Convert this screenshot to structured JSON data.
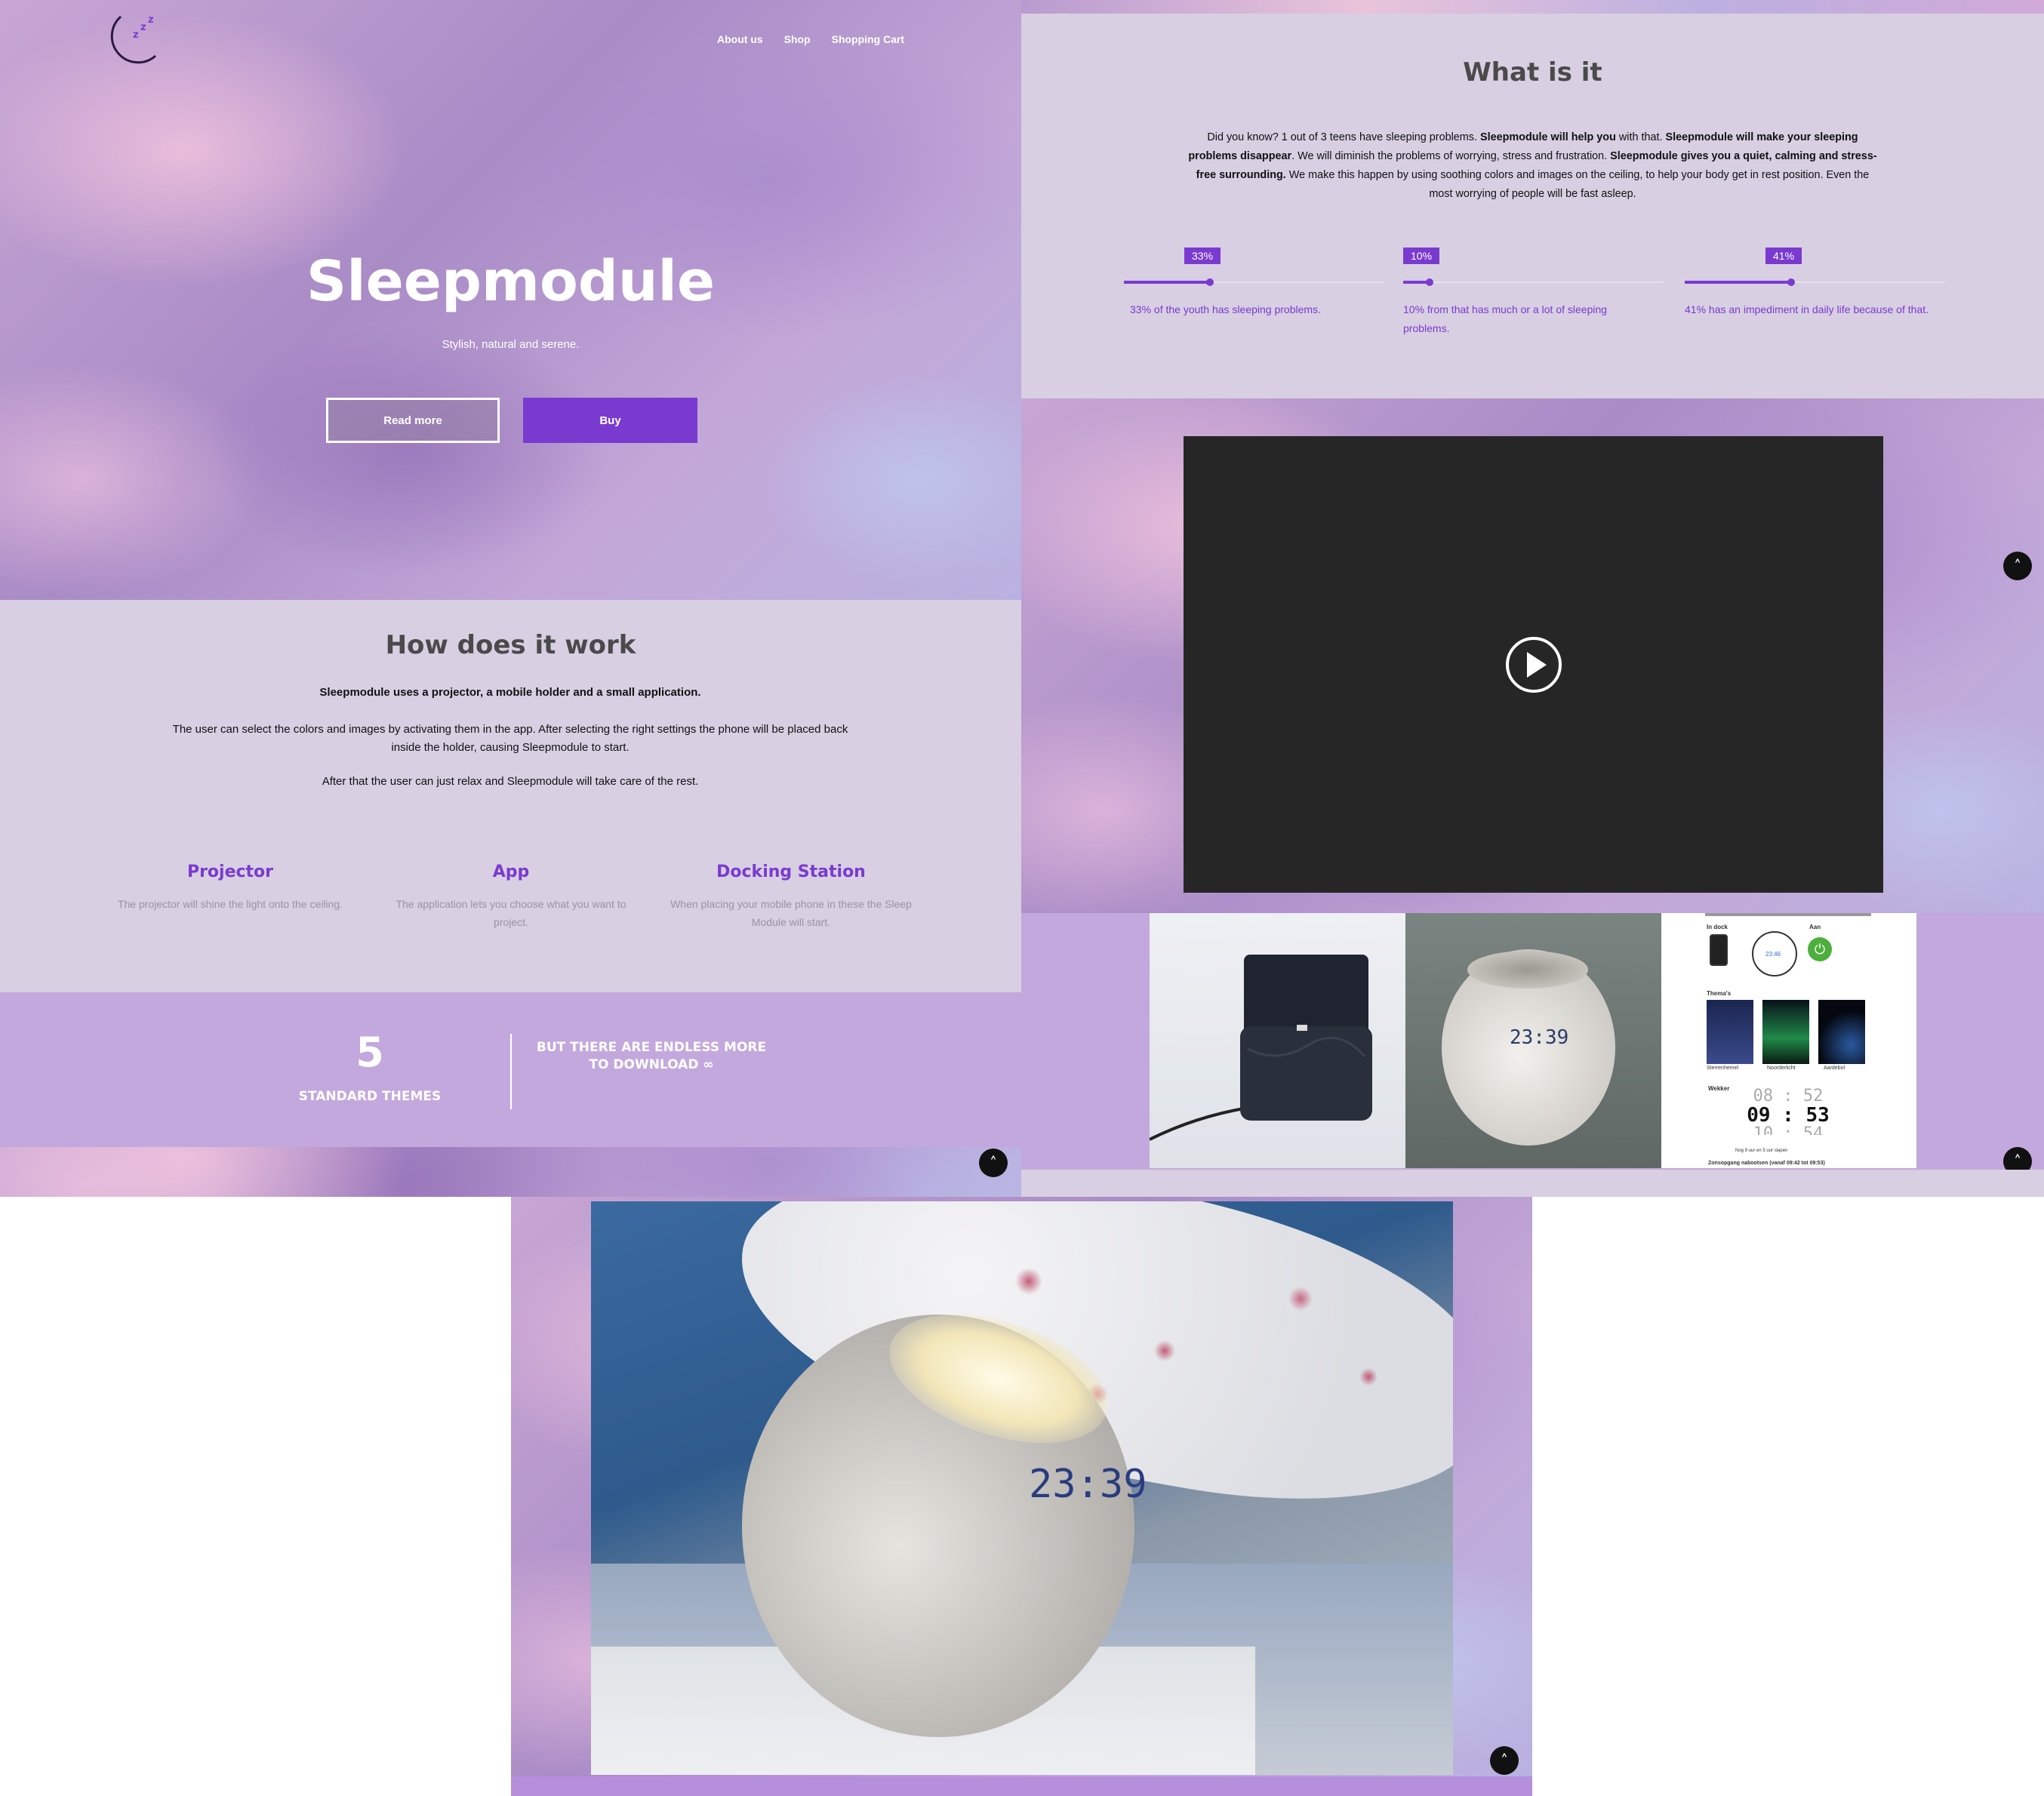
{
  "nav": {
    "about": "About us",
    "shop": "Shop",
    "cart": "Shopping Cart"
  },
  "hero": {
    "title": "Sleepmodule",
    "subtitle": "Stylish, natural and serene.",
    "read_more": "Read more",
    "buy": "Buy"
  },
  "how": {
    "title": "How does it work",
    "lead": "Sleepmodule uses a projector, a mobile holder and a small application.",
    "p1": "The user can select the colors and images by activating them in the app. After selecting the right settings the phone will be placed back inside the holder, causing Sleepmodule to start.",
    "p2": "After that the user can just relax and Sleepmodule will take care of the rest."
  },
  "features": [
    {
      "title": "Projector",
      "text": "The projector will shine the light onto the ceiling."
    },
    {
      "title": "App",
      "text": "The application lets you choose what you want to project."
    },
    {
      "title": "Docking Station",
      "text": "When placing your mobile phone in these the Sleep Module will start."
    }
  ],
  "themes": {
    "count": "5",
    "label": "STANDARD THEMES",
    "more": "BUT THERE ARE ENDLESS MORE TO DOWNLOAD ∞"
  },
  "what": {
    "title": "What is it",
    "intro_parts": [
      {
        "t": "Did you know? 1 out of 3 teens have sleeping problems. ",
        "b": false
      },
      {
        "t": "Sleepmodule will help you",
        "b": true
      },
      {
        "t": " with that. ",
        "b": false
      },
      {
        "t": "Sleepmodule will make your sleeping problems disappear",
        "b": true
      },
      {
        "t": ". We will diminish the problems of worrying, stress and frustration. ",
        "b": false
      },
      {
        "t": "Sleepmodule gives you a quiet, calming and stress-free surrounding.",
        "b": true
      },
      {
        "t": " We make this happen by using soothing colors and images on the ceiling, to help your body get in rest position. Even the most worrying of people will be fast asleep.",
        "b": false
      }
    ]
  },
  "stats": [
    {
      "badge": "33%",
      "value": 0.33,
      "text": "33% of the youth has sleeping problems."
    },
    {
      "badge": "10%",
      "value": 0.1,
      "text": "10% from that has much or a lot of sleeping problems."
    },
    {
      "badge": "41%",
      "value": 0.41,
      "text": "41% has an impediment in daily life because of that."
    }
  ],
  "app_screen": {
    "label_dock": "In dock",
    "label_on": "Aan",
    "clock_small": "23:46",
    "themes_label": "Thema's",
    "theme_names": [
      "Sterrenhemel",
      "Noorderlicht",
      "Aardebol"
    ],
    "alarm_label": "Wekker",
    "time_rows": [
      [
        "08",
        "52"
      ],
      [
        "09",
        "53"
      ],
      [
        "10",
        "54"
      ]
    ],
    "sleep_text": "Nog 9 uur en 5 uur slapen",
    "sunrise_text": "Zonsopgang nabootsen (vanaf 09:42 tot 09:53)"
  },
  "product_clock": "23:39",
  "colors": {
    "accent": "#7a3ad0",
    "lavender": "#d8cfe2",
    "band": "#c3a8dd",
    "video": "#262626"
  }
}
